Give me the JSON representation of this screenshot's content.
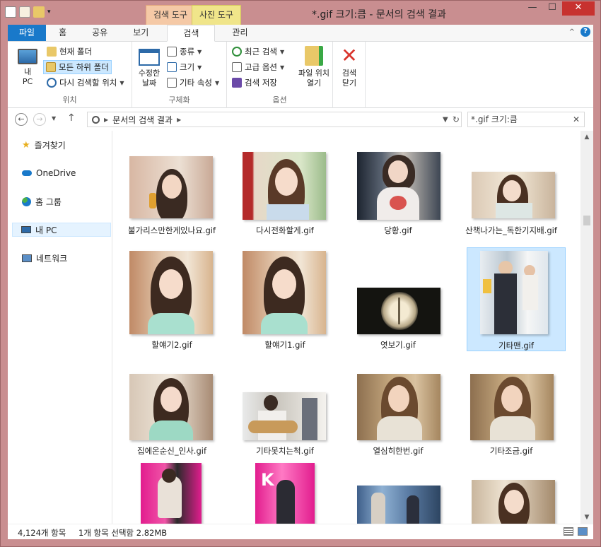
{
  "window": {
    "title": "*.gif 크기:큼 - 문서의 검색 결과",
    "context_tabs": {
      "search_tools": "검색 도구",
      "photo_tools": "사진 도구"
    },
    "controls": {
      "minimize": "—",
      "maximize": "☐",
      "close": "✕"
    }
  },
  "ribbon_tabs": [
    "파일",
    "홈",
    "공유",
    "보기",
    "검색",
    "관리"
  ],
  "ribbon_tabs_active": "검색",
  "ribbon": {
    "location": {
      "label": "위치",
      "this_pc": "내\nPC",
      "current_folder": "현재 폴더",
      "all_subfolders": "모든 하위 폴더",
      "search_again_in": "다시 검색할 위치"
    },
    "refine": {
      "label": "구체화",
      "date_modified": "수정한\n날짜",
      "kind": "종류",
      "size": "크기",
      "other_properties": "기타 속성"
    },
    "options": {
      "label": "옵션",
      "recent_searches": "최근 검색",
      "advanced_options": "고급 옵션",
      "save_search": "검색 저장",
      "open_file_location": "파일 위치\n열기"
    },
    "close_search": "검색\n닫기"
  },
  "address": {
    "crumb": "문서의 검색 결과",
    "search_value": "*.gif 크기:큼"
  },
  "nav_pane": [
    {
      "label": "즐겨찾기",
      "icon": "star-icon"
    },
    {
      "label": "OneDrive",
      "icon": "cloud-icon"
    },
    {
      "label": "홈 그룹",
      "icon": "homegroup-icon"
    },
    {
      "label": "내 PC",
      "icon": "computer-icon"
    },
    {
      "label": "네트워크",
      "icon": "network-icon"
    }
  ],
  "files": [
    {
      "name": "불가리스만한게있나요.gif"
    },
    {
      "name": "다시전화할게.gif"
    },
    {
      "name": "당황.gif"
    },
    {
      "name": "산책나가는_독한기지배.gif"
    },
    {
      "name": "할얘기2.gif"
    },
    {
      "name": "할얘기1.gif"
    },
    {
      "name": "엿보기.gif"
    },
    {
      "name": "기타맨.gif",
      "selected": true
    },
    {
      "name": "집에온순신_인사.gif"
    },
    {
      "name": "기타못치는척.gif"
    },
    {
      "name": "열심히한번.gif"
    },
    {
      "name": "기타조금.gif"
    },
    {
      "name": ""
    },
    {
      "name": ""
    },
    {
      "name": ""
    },
    {
      "name": ""
    }
  ],
  "status": {
    "item_count": "4,124개 항목",
    "selection": "1개 항목 선택함 2.82MB"
  },
  "colors": {
    "accent": "#1979ca",
    "frame": "#c98e90",
    "selection": "#cce8ff"
  }
}
